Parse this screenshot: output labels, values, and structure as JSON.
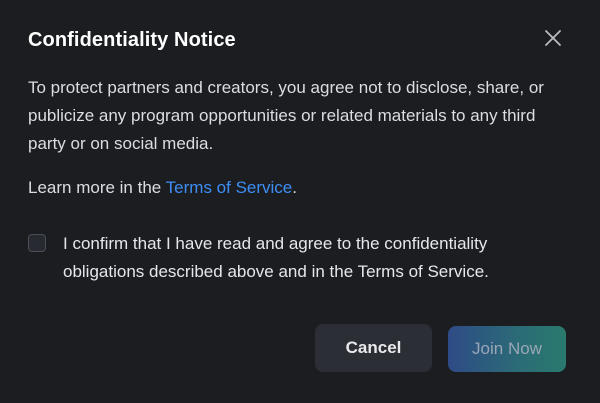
{
  "dialog": {
    "title": "Confidentiality Notice",
    "body": "To protect partners and creators, you agree not to disclose, share, or publicize any program opportunities or related materials to any third party or on social media.",
    "learn_more_prefix": "Learn more in the ",
    "learn_more_link": "Terms of Service",
    "learn_more_suffix": ".",
    "confirm_label": "I confirm that I have read and agree to the confidentiality obligations described above and in the Terms of Service.",
    "confirm_checked": false,
    "close_icon": "close-icon",
    "buttons": {
      "cancel_label": "Cancel",
      "join_label": "Join Now",
      "join_enabled": false
    }
  },
  "colors": {
    "background": "#1b1d21",
    "link": "#3d8ef5",
    "cancel_bg": "#2b2e34",
    "join_gradient_start": "#2e4b86",
    "join_gradient_end": "#2a7a6e"
  }
}
